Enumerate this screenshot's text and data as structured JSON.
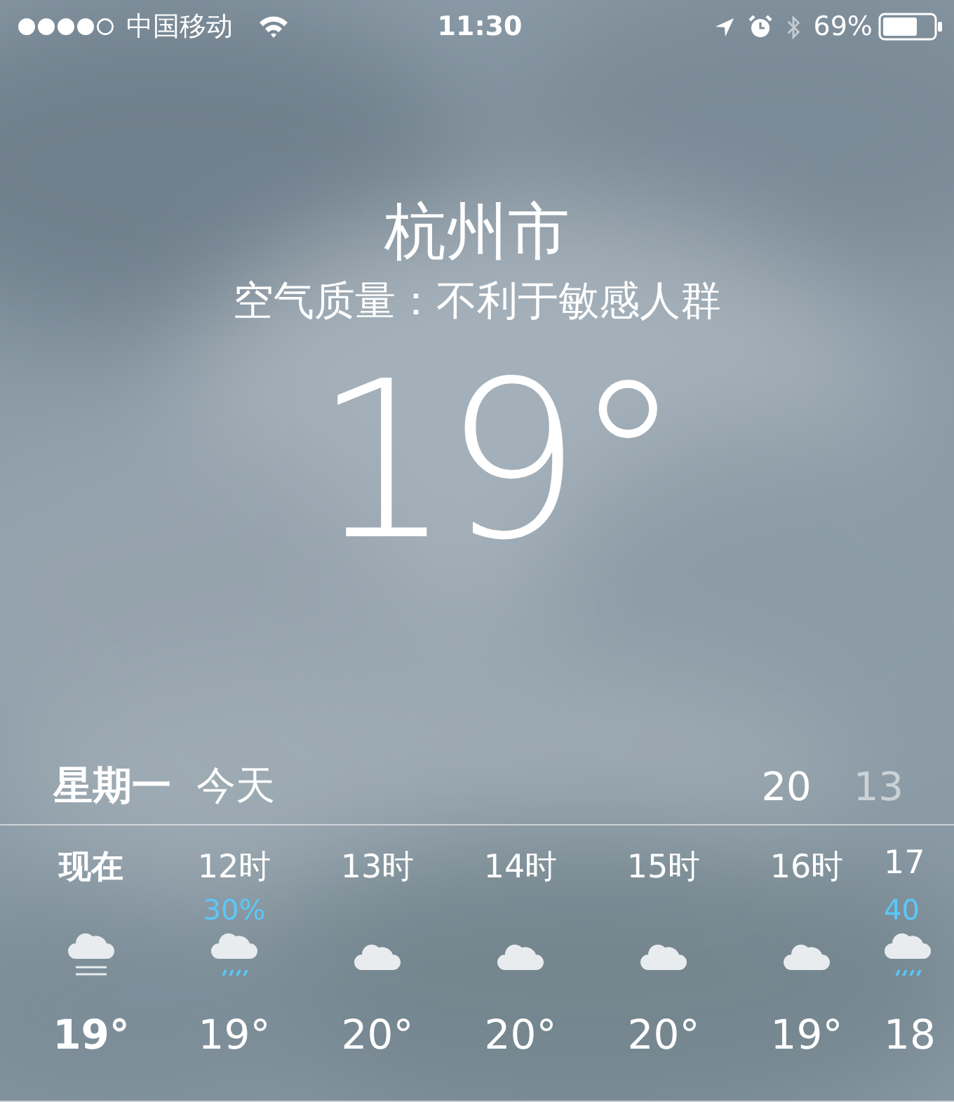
{
  "status_bar": {
    "carrier": "中国移动",
    "time": "11:30",
    "battery": "69%"
  },
  "city": "杭州市",
  "air_quality": "空气质量：不利于敏感人群",
  "temperature": "19°",
  "day": {
    "weekday": "星期一",
    "label": "今天",
    "high": "20",
    "low": "13"
  },
  "hours": [
    {
      "time": "现在",
      "kind": "fog",
      "temp": "19°",
      "current": true
    },
    {
      "time": "12时",
      "precip": "30%",
      "kind": "rain",
      "temp": "19°",
      "current": false
    },
    {
      "time": "13时",
      "kind": "cloud",
      "temp": "20°",
      "current": false
    },
    {
      "time": "14时",
      "kind": "cloud",
      "temp": "20°",
      "current": false
    },
    {
      "time": "15时",
      "kind": "cloud",
      "temp": "20°",
      "current": false
    },
    {
      "time": "16时",
      "kind": "cloud",
      "temp": "19°",
      "current": false
    },
    {
      "time": "17",
      "precip": "40",
      "kind": "rain",
      "temp": "18",
      "current": false
    }
  ]
}
